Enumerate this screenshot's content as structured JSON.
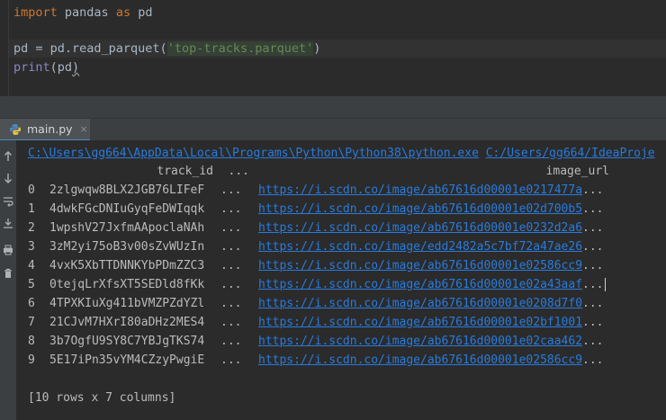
{
  "editor": {
    "line1": {
      "kw1": "import",
      "mid": " pandas ",
      "kw2": "as",
      "tail": " pd"
    },
    "line3": {
      "pre": "pd = pd.read_parquet(",
      "str": "'top-tracks.parquet'",
      "post": ")"
    },
    "line4": {
      "fn": "print",
      "open": "(",
      "arg": "pd",
      "close": ")"
    }
  },
  "run_tab": {
    "label": "main.py",
    "close": "×"
  },
  "console": {
    "command_path": "C:\\Users\\gg664\\AppData\\Local\\Programs\\Python\\Python38\\python.exe",
    "script_path": "C:/Users/gg664/IdeaProje",
    "header": {
      "col1": "track_id",
      "ellipsis": "...",
      "col2": "image_url"
    },
    "rows": [
      {
        "idx": "0",
        "track_id": "2zlgwqw8BLX2JGB76LIFeF",
        "gap": "...",
        "url": "https://i.scdn.co/image/ab67616d00001e0217477a",
        "tail": "..."
      },
      {
        "idx": "1",
        "track_id": "4dwkFGcDNIuGyqFeDWIqqk",
        "gap": "...",
        "url": "https://i.scdn.co/image/ab67616d00001e02d700b5",
        "tail": "..."
      },
      {
        "idx": "2",
        "track_id": "1wpshV27JxfmAApoclaNAh",
        "gap": "...",
        "url": "https://i.scdn.co/image/ab67616d00001e0232d2a6",
        "tail": "..."
      },
      {
        "idx": "3",
        "track_id": "3zM2yi75oB3v00sZvWUzIn",
        "gap": "...",
        "url": "https://i.scdn.co/image/edd2482a5c7bf72a47ae26",
        "tail": "..."
      },
      {
        "idx": "4",
        "track_id": "4vxK5XbTTDNNKYbPDmZZC3",
        "gap": "...",
        "url": "https://i.scdn.co/image/ab67616d00001e02586cc9",
        "tail": "..."
      },
      {
        "idx": "5",
        "track_id": "0tejqLrXfsXT5SEDld8fKk",
        "gap": "...",
        "url": "https://i.scdn.co/image/ab67616d00001e02a43aaf",
        "tail": "..."
      },
      {
        "idx": "6",
        "track_id": "4TPXKIuXg411bVMZPZdYZl",
        "gap": "...",
        "url": "https://i.scdn.co/image/ab67616d00001e0208d7f0",
        "tail": "..."
      },
      {
        "idx": "7",
        "track_id": "21CJvM7HXrI80aDHz2MES4",
        "gap": "...",
        "url": "https://i.scdn.co/image/ab67616d00001e02bf1001",
        "tail": "..."
      },
      {
        "idx": "8",
        "track_id": "3b7OgfU9SY8C7YBJgTKS74",
        "gap": "...",
        "url": "https://i.scdn.co/image/ab67616d00001e02caa462",
        "tail": "..."
      },
      {
        "idx": "9",
        "track_id": "5E17iPn35vYM4CZzyPwgiE",
        "gap": "...",
        "url": "https://i.scdn.co/image/ab67616d00001e02586cc9",
        "tail": "..."
      }
    ],
    "summary": "[10 rows x 7 columns]"
  },
  "toolbar_icons": [
    "arrow-up-icon",
    "arrow-down-icon",
    "soft-wrap-icon",
    "scroll-to-end-icon",
    "print-icon",
    "trash-icon"
  ],
  "colors": {
    "background": "#2b2b2b",
    "keyword": "#cc7832",
    "string": "#6a8759",
    "link": "#287bde",
    "panel": "#3c3f41"
  }
}
